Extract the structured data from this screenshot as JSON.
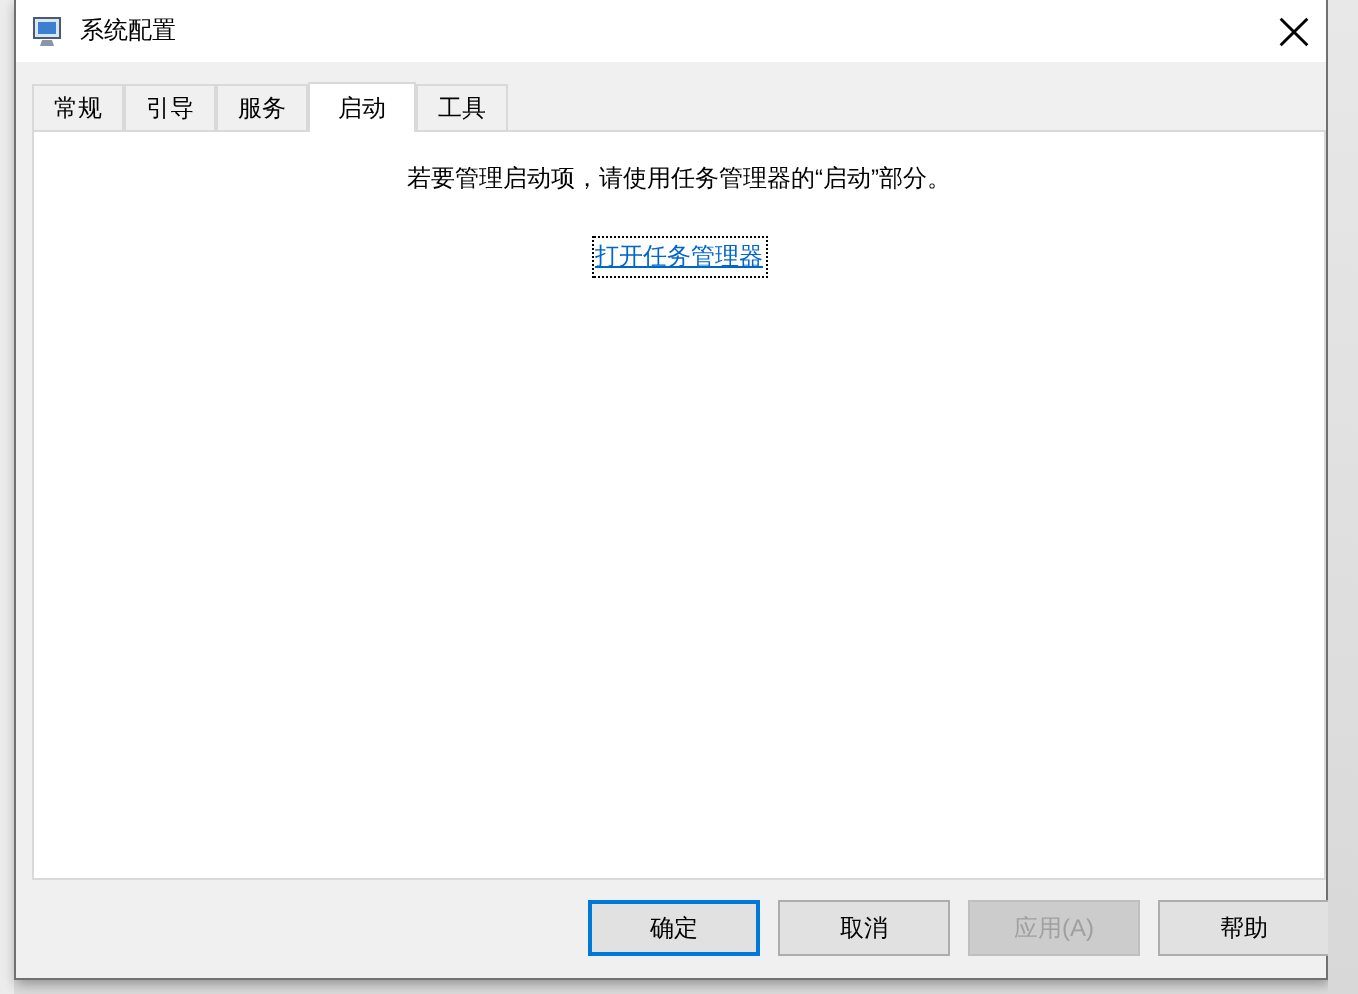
{
  "window": {
    "title": "系统配置"
  },
  "tabs": [
    {
      "label": "常规",
      "selected": false
    },
    {
      "label": "引导",
      "selected": false
    },
    {
      "label": "服务",
      "selected": false
    },
    {
      "label": "启动",
      "selected": true
    },
    {
      "label": "工具",
      "selected": false
    }
  ],
  "panel": {
    "message": "若要管理启动项，请使用任务管理器的“启动”部分。",
    "link": "打开任务管理器"
  },
  "buttons": [
    {
      "label": "确定",
      "default": true,
      "disabled": false
    },
    {
      "label": "取消",
      "default": false,
      "disabled": false
    },
    {
      "label": "应用(A)",
      "default": false,
      "disabled": true
    },
    {
      "label": "帮助",
      "default": false,
      "disabled": false
    }
  ]
}
